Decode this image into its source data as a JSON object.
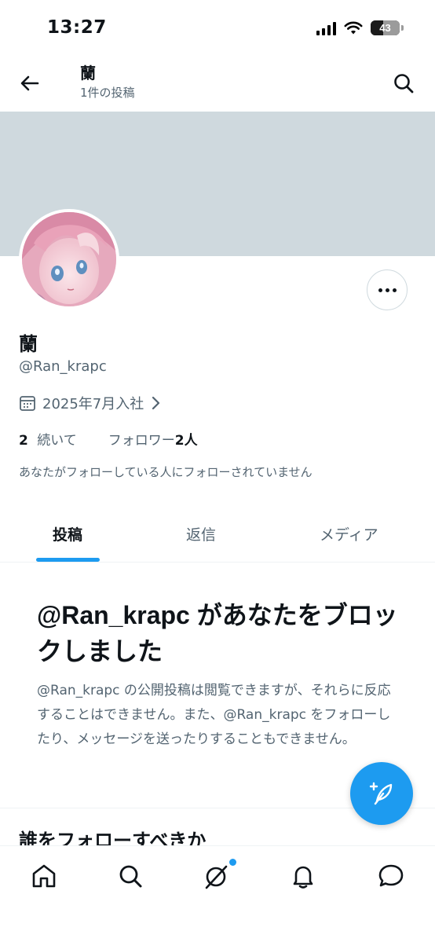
{
  "status": {
    "time": "13:27",
    "battery": "43",
    "battery_level": 0.43
  },
  "header": {
    "title": "蘭",
    "subtitle": "1件の投稿"
  },
  "profile": {
    "name": "蘭",
    "handle": "@Ran_krapc",
    "joined": "2025年7月入社",
    "following_count": "2",
    "following_label": "続いて",
    "followers_label": "フォロワー",
    "followers_count": "2人",
    "follow_note": "あなたがフォローしている人にフォローされていません"
  },
  "tabs": [
    {
      "label": "投稿",
      "active": true
    },
    {
      "label": "返信",
      "active": false
    },
    {
      "label": "メディア",
      "active": false
    }
  ],
  "blocked": {
    "title": "@Ran_krapc があなたをブロックしました",
    "body": "@Ran_krapc の公開投稿は閲覧できますが、それらに反応することはできません。また、@Ran_krapc をフォローしたり、メッセージを送ったりすることもできません。"
  },
  "section": {
    "who_to_follow": "誰をフォローすべきか"
  },
  "bottom_nav": [
    {
      "name": "home",
      "icon": "home-icon"
    },
    {
      "name": "search",
      "icon": "search-icon"
    },
    {
      "name": "grok",
      "icon": "grok-icon"
    },
    {
      "name": "notifications",
      "icon": "bell-icon"
    },
    {
      "name": "messages",
      "icon": "chat-bubble-icon"
    }
  ],
  "colors": {
    "accent": "#1d9bf0",
    "banner": "#cfd9de",
    "text": "#0f1419",
    "muted": "#536471"
  }
}
